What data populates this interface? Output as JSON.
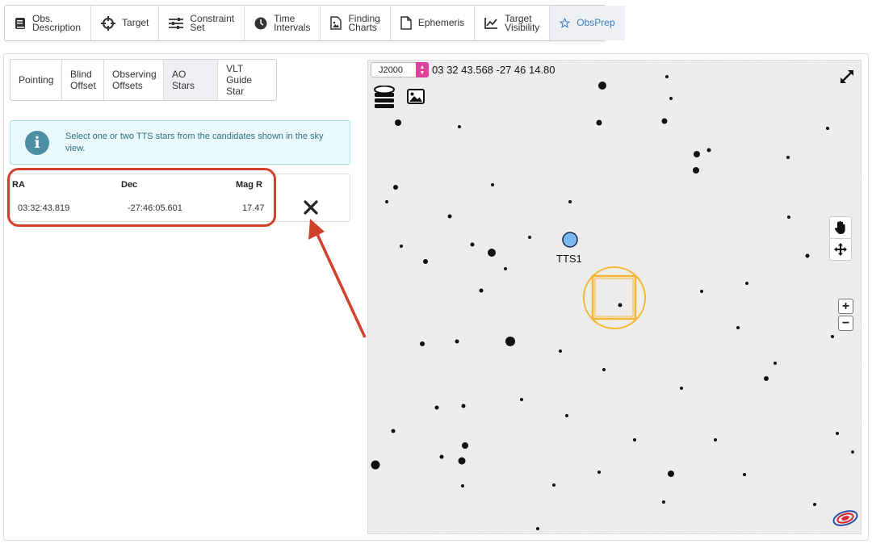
{
  "top_tabs": [
    {
      "label": "Obs. Description",
      "line1": "Obs.",
      "line2": "Description",
      "icon": "book-icon"
    },
    {
      "label": "Target",
      "icon": "crosshair-icon"
    },
    {
      "label": "Constraint Set",
      "line1": "Constraint",
      "line2": "Set",
      "icon": "sliders-icon"
    },
    {
      "label": "Time Intervals",
      "line1": "Time",
      "line2": "Intervals",
      "icon": "clock-icon"
    },
    {
      "label": "Finding Charts",
      "line1": "Finding",
      "line2": "Charts",
      "icon": "image-file-icon"
    },
    {
      "label": "Ephemeris",
      "icon": "file-icon"
    },
    {
      "label": "Target Visibility",
      "line1": "Target",
      "line2": "Visibility",
      "icon": "line-chart-icon"
    },
    {
      "label": "ObsPrep",
      "icon": "star-icon",
      "active": true
    }
  ],
  "sub_tabs": [
    {
      "line1": "Pointing",
      "line2": ""
    },
    {
      "line1": "Blind",
      "line2": "Offset"
    },
    {
      "line1": "Observing",
      "line2": "Offsets"
    },
    {
      "line1": "AO Stars",
      "line2": "",
      "active": true
    },
    {
      "line1": "VLT Guide",
      "line2": "Star"
    }
  ],
  "alert": {
    "message": "Select one or two TTS stars from the candidates shown in the sky view."
  },
  "table": {
    "headers": {
      "ra": "RA",
      "dec": "Dec",
      "mag": "Mag R"
    },
    "rows": [
      {
        "ra": "03:32:43.819",
        "dec": "-27:46:05.601",
        "mag": "17.47"
      }
    ]
  },
  "sky": {
    "epoch": "J2000",
    "coordinates": "03 32 43.568 -27 46 14.80",
    "star_label": "TTS1",
    "zoom_in": "+",
    "zoom_out": "−"
  },
  "colors": {
    "accent": "#3a7fc1",
    "annotation_red": "#d1412a",
    "fov_orange": "#f5b731",
    "tts_blue": "#7ab8f5",
    "alert_text": "#2f6f82"
  }
}
